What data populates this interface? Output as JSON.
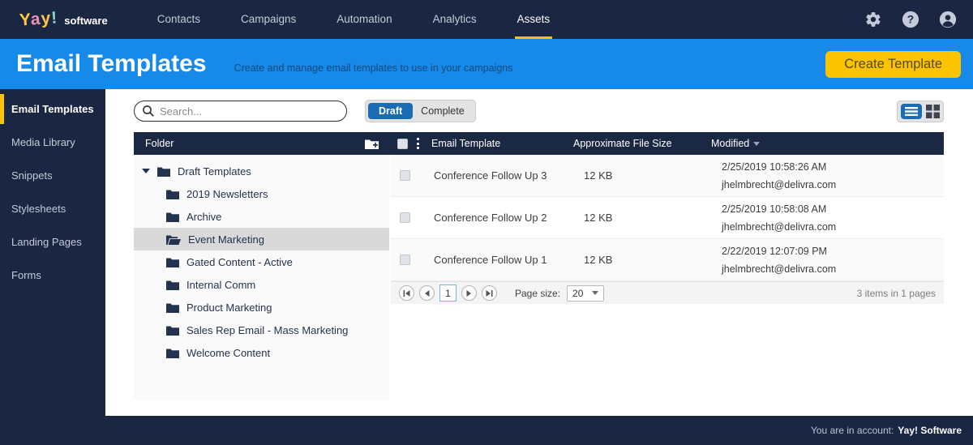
{
  "brand": {
    "letters": [
      "Y",
      "a",
      "y",
      "!"
    ],
    "suffix": "software"
  },
  "nav": {
    "items": [
      {
        "label": "Contacts",
        "active": false
      },
      {
        "label": "Campaigns",
        "active": false
      },
      {
        "label": "Automation",
        "active": false
      },
      {
        "label": "Analytics",
        "active": false
      },
      {
        "label": "Assets",
        "active": true
      }
    ],
    "icons": [
      "settings",
      "help",
      "account"
    ]
  },
  "header": {
    "title": "Email Templates",
    "subtitle": "Create and manage email templates to use in your campaigns",
    "create_button": "Create Template"
  },
  "sidebar": {
    "items": [
      {
        "label": "Email Templates",
        "active": true
      },
      {
        "label": "Media Library",
        "active": false
      },
      {
        "label": "Snippets",
        "active": false
      },
      {
        "label": "Stylesheets",
        "active": false
      },
      {
        "label": "Landing Pages",
        "active": false
      },
      {
        "label": "Forms",
        "active": false
      }
    ]
  },
  "toolbar": {
    "search_placeholder": "Search...",
    "toggle": {
      "draft": "Draft",
      "complete": "Complete",
      "selected": "Draft"
    },
    "view_mode": "list"
  },
  "table": {
    "headers": {
      "folder": "Folder",
      "email_template": "Email Template",
      "file_size": "Approximate File Size",
      "modified": "Modified"
    },
    "sort": {
      "column": "Modified",
      "direction": "desc"
    }
  },
  "tree": {
    "root": {
      "label": "Draft Templates",
      "expanded": true
    },
    "children": [
      {
        "label": "2019 Newsletters",
        "selected": false
      },
      {
        "label": "Archive",
        "selected": false
      },
      {
        "label": "Event Marketing",
        "selected": true
      },
      {
        "label": "Gated Content - Active",
        "selected": false
      },
      {
        "label": "Internal Comm",
        "selected": false
      },
      {
        "label": "Product Marketing",
        "selected": false
      },
      {
        "label": "Sales Rep Email - Mass Marketing",
        "selected": false
      },
      {
        "label": "Welcome Content",
        "selected": false
      }
    ]
  },
  "rows": [
    {
      "name": "Conference Follow Up 3",
      "size": "12 KB",
      "modified_date": "2/25/2019 10:58:26 AM",
      "modified_by": "jhelmbrecht@delivra.com"
    },
    {
      "name": "Conference Follow Up 2",
      "size": "12 KB",
      "modified_date": "2/25/2019 10:58:08 AM",
      "modified_by": "jhelmbrecht@delivra.com"
    },
    {
      "name": "Conference Follow Up 1",
      "size": "12 KB",
      "modified_date": "2/22/2019 12:07:09 PM",
      "modified_by": "jhelmbrecht@delivra.com"
    }
  ],
  "pagination": {
    "current_page": "1",
    "page_size_label": "Page size:",
    "page_size": "20",
    "summary": "3 items in 1 pages"
  },
  "footer": {
    "prefix": "You are in account:",
    "account": "Yay! Software"
  },
  "colors": {
    "navy": "#1b2642",
    "band_blue": "#1789e8",
    "accent_yellow": "#fcc400",
    "draft_blue": "#1a6cb5"
  }
}
